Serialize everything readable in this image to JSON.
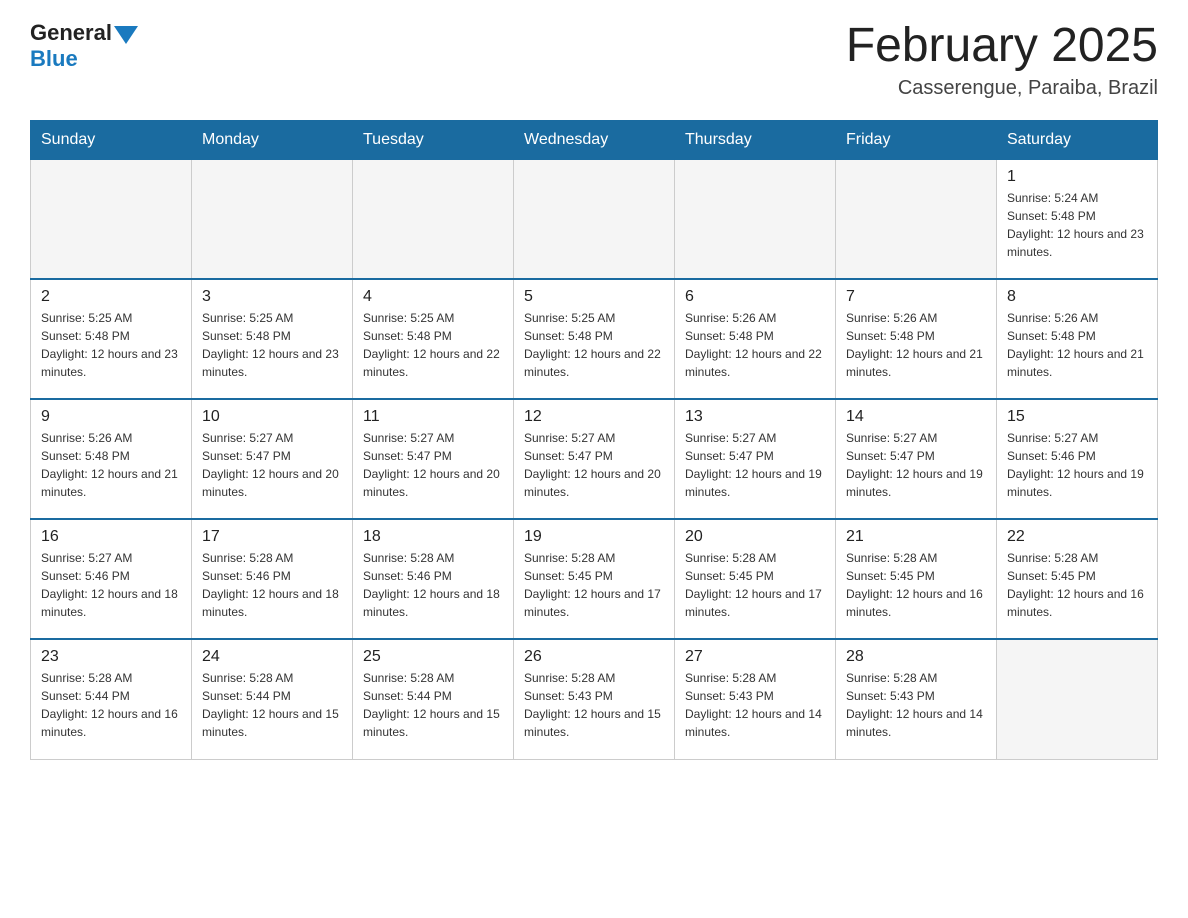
{
  "header": {
    "logo_general": "General",
    "logo_blue": "Blue",
    "title": "February 2025",
    "subtitle": "Casserengue, Paraiba, Brazil"
  },
  "weekdays": [
    "Sunday",
    "Monday",
    "Tuesday",
    "Wednesday",
    "Thursday",
    "Friday",
    "Saturday"
  ],
  "weeks": [
    [
      {
        "day": "",
        "info": ""
      },
      {
        "day": "",
        "info": ""
      },
      {
        "day": "",
        "info": ""
      },
      {
        "day": "",
        "info": ""
      },
      {
        "day": "",
        "info": ""
      },
      {
        "day": "",
        "info": ""
      },
      {
        "day": "1",
        "info": "Sunrise: 5:24 AM\nSunset: 5:48 PM\nDaylight: 12 hours and 23 minutes."
      }
    ],
    [
      {
        "day": "2",
        "info": "Sunrise: 5:25 AM\nSunset: 5:48 PM\nDaylight: 12 hours and 23 minutes."
      },
      {
        "day": "3",
        "info": "Sunrise: 5:25 AM\nSunset: 5:48 PM\nDaylight: 12 hours and 23 minutes."
      },
      {
        "day": "4",
        "info": "Sunrise: 5:25 AM\nSunset: 5:48 PM\nDaylight: 12 hours and 22 minutes."
      },
      {
        "day": "5",
        "info": "Sunrise: 5:25 AM\nSunset: 5:48 PM\nDaylight: 12 hours and 22 minutes."
      },
      {
        "day": "6",
        "info": "Sunrise: 5:26 AM\nSunset: 5:48 PM\nDaylight: 12 hours and 22 minutes."
      },
      {
        "day": "7",
        "info": "Sunrise: 5:26 AM\nSunset: 5:48 PM\nDaylight: 12 hours and 21 minutes."
      },
      {
        "day": "8",
        "info": "Sunrise: 5:26 AM\nSunset: 5:48 PM\nDaylight: 12 hours and 21 minutes."
      }
    ],
    [
      {
        "day": "9",
        "info": "Sunrise: 5:26 AM\nSunset: 5:48 PM\nDaylight: 12 hours and 21 minutes."
      },
      {
        "day": "10",
        "info": "Sunrise: 5:27 AM\nSunset: 5:47 PM\nDaylight: 12 hours and 20 minutes."
      },
      {
        "day": "11",
        "info": "Sunrise: 5:27 AM\nSunset: 5:47 PM\nDaylight: 12 hours and 20 minutes."
      },
      {
        "day": "12",
        "info": "Sunrise: 5:27 AM\nSunset: 5:47 PM\nDaylight: 12 hours and 20 minutes."
      },
      {
        "day": "13",
        "info": "Sunrise: 5:27 AM\nSunset: 5:47 PM\nDaylight: 12 hours and 19 minutes."
      },
      {
        "day": "14",
        "info": "Sunrise: 5:27 AM\nSunset: 5:47 PM\nDaylight: 12 hours and 19 minutes."
      },
      {
        "day": "15",
        "info": "Sunrise: 5:27 AM\nSunset: 5:46 PM\nDaylight: 12 hours and 19 minutes."
      }
    ],
    [
      {
        "day": "16",
        "info": "Sunrise: 5:27 AM\nSunset: 5:46 PM\nDaylight: 12 hours and 18 minutes."
      },
      {
        "day": "17",
        "info": "Sunrise: 5:28 AM\nSunset: 5:46 PM\nDaylight: 12 hours and 18 minutes."
      },
      {
        "day": "18",
        "info": "Sunrise: 5:28 AM\nSunset: 5:46 PM\nDaylight: 12 hours and 18 minutes."
      },
      {
        "day": "19",
        "info": "Sunrise: 5:28 AM\nSunset: 5:45 PM\nDaylight: 12 hours and 17 minutes."
      },
      {
        "day": "20",
        "info": "Sunrise: 5:28 AM\nSunset: 5:45 PM\nDaylight: 12 hours and 17 minutes."
      },
      {
        "day": "21",
        "info": "Sunrise: 5:28 AM\nSunset: 5:45 PM\nDaylight: 12 hours and 16 minutes."
      },
      {
        "day": "22",
        "info": "Sunrise: 5:28 AM\nSunset: 5:45 PM\nDaylight: 12 hours and 16 minutes."
      }
    ],
    [
      {
        "day": "23",
        "info": "Sunrise: 5:28 AM\nSunset: 5:44 PM\nDaylight: 12 hours and 16 minutes."
      },
      {
        "day": "24",
        "info": "Sunrise: 5:28 AM\nSunset: 5:44 PM\nDaylight: 12 hours and 15 minutes."
      },
      {
        "day": "25",
        "info": "Sunrise: 5:28 AM\nSunset: 5:44 PM\nDaylight: 12 hours and 15 minutes."
      },
      {
        "day": "26",
        "info": "Sunrise: 5:28 AM\nSunset: 5:43 PM\nDaylight: 12 hours and 15 minutes."
      },
      {
        "day": "27",
        "info": "Sunrise: 5:28 AM\nSunset: 5:43 PM\nDaylight: 12 hours and 14 minutes."
      },
      {
        "day": "28",
        "info": "Sunrise: 5:28 AM\nSunset: 5:43 PM\nDaylight: 12 hours and 14 minutes."
      },
      {
        "day": "",
        "info": ""
      }
    ]
  ]
}
